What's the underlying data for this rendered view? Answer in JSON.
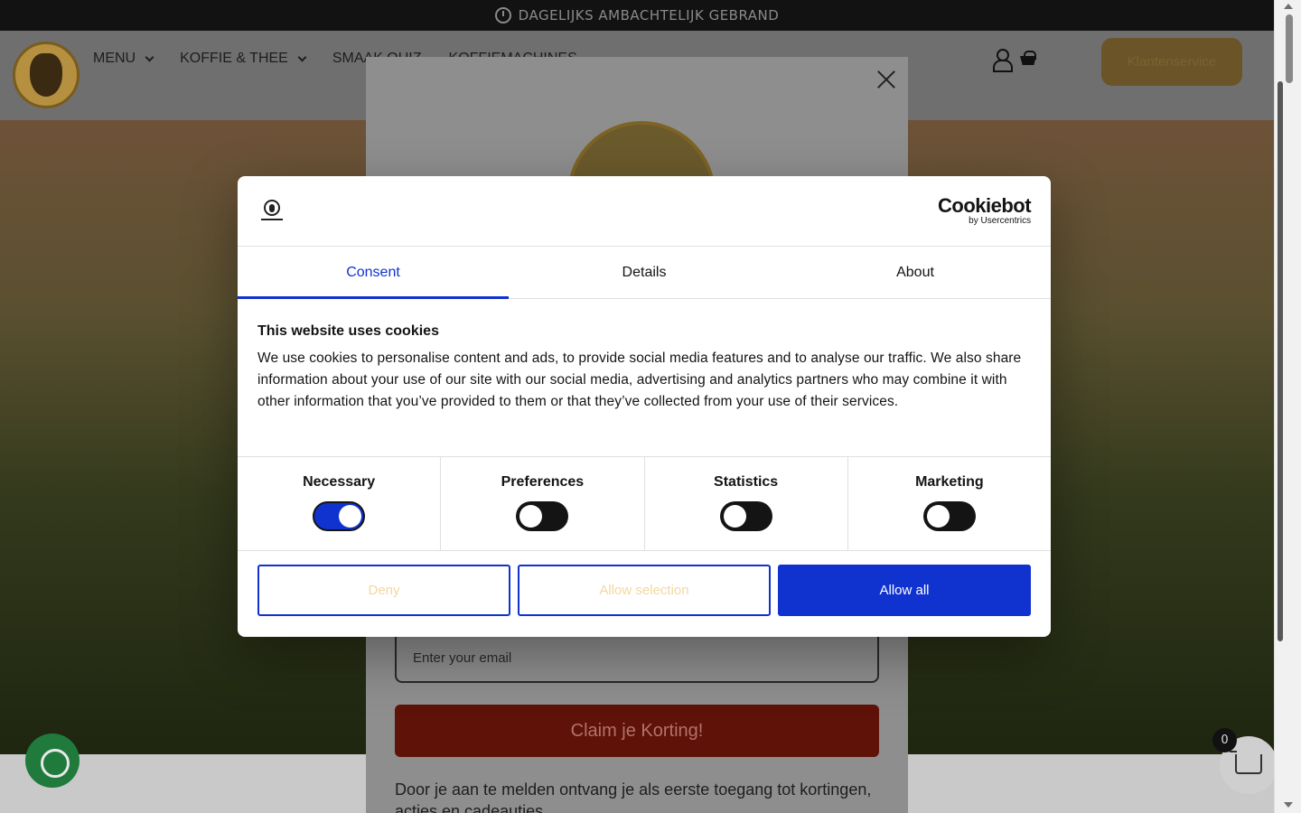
{
  "announcement": {
    "text": "DAGELIJKS AMBACHTELIJK GEBRAND"
  },
  "nav": {
    "items": [
      {
        "label": "MENU"
      },
      {
        "label": "KOFFIE & THEE"
      },
      {
        "label": "SMAAK QUIZ"
      },
      {
        "label": "KOFFIEMACHINES"
      }
    ],
    "service_button": "Klantenservice"
  },
  "newsletter_popup": {
    "email_placeholder": "Enter your email",
    "claim_button": "Claim je Korting!",
    "footer_text": "Door je aan te melden ontvang je als eerste toegang tot kortingen, acties en cadeautjes."
  },
  "cart": {
    "count": "0"
  },
  "cookie_dialog": {
    "brand": {
      "name": "Cookiebot",
      "sub": "by Usercentrics"
    },
    "tabs": [
      {
        "label": "Consent",
        "active": true
      },
      {
        "label": "Details",
        "active": false
      },
      {
        "label": "About",
        "active": false
      }
    ],
    "heading": "This website uses cookies",
    "body": "We use cookies to personalise content and ads, to provide social media features and to analyse our traffic. We also share information about your use of our site with our social media, advertising and analytics partners who may combine it with other information that you’ve provided to them or that they’ve collected from your use of their services.",
    "toggles": [
      {
        "label": "Necessary",
        "on": true
      },
      {
        "label": "Preferences",
        "on": false
      },
      {
        "label": "Statistics",
        "on": false
      },
      {
        "label": "Marketing",
        "on": false
      }
    ],
    "buttons": {
      "deny": "Deny",
      "allow_selection": "Allow selection",
      "allow_all": "Allow all"
    }
  },
  "colors": {
    "accent": "#1032cf",
    "claim": "#5e1208",
    "gold": "#b59040"
  }
}
